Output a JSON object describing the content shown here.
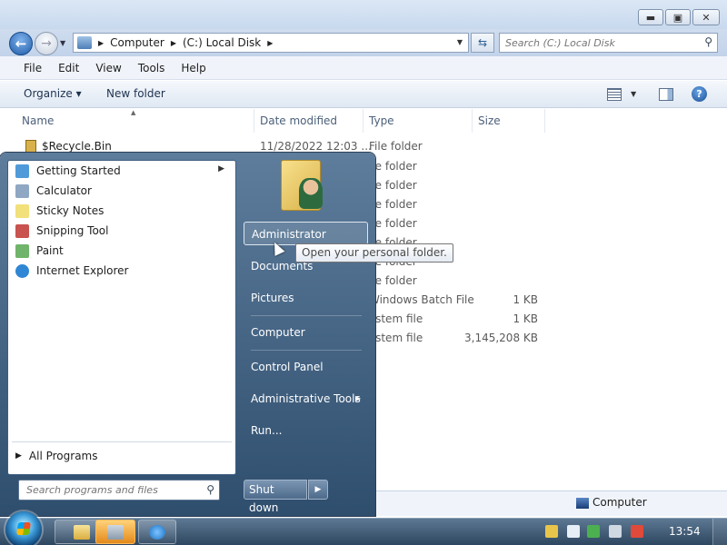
{
  "explorer": {
    "window_buttons": {
      "minimize": "▬",
      "maximize": "▣",
      "close": "✕"
    },
    "address": {
      "crumbs": [
        "Computer",
        "(C:) Local Disk"
      ]
    },
    "search": {
      "placeholder": "Search (C:) Local Disk"
    },
    "menu": [
      "File",
      "Edit",
      "View",
      "Tools",
      "Help"
    ],
    "commands": {
      "organize": "Organize ▾",
      "new_folder": "New folder"
    },
    "columns": [
      "Name",
      "Date modified",
      "Type",
      "Size"
    ],
    "files": [
      {
        "name": "$Recycle.Bin",
        "date": "11/28/2022 12:03 ...",
        "type": "File folder",
        "size": ""
      },
      {
        "name": "",
        "date": "",
        "type": "ile folder",
        "size": ""
      },
      {
        "name": "",
        "date": "",
        "type": "ile folder",
        "size": ""
      },
      {
        "name": "",
        "date": "",
        "type": "ile folder",
        "size": ""
      },
      {
        "name": "",
        "date": "",
        "type": "ile folder",
        "size": ""
      },
      {
        "name": "",
        "date": "",
        "type": "ile folder",
        "size": ""
      },
      {
        "name": "",
        "date": "",
        "type": "ile folder",
        "size": ""
      },
      {
        "name": "",
        "date": "",
        "type": "ile folder",
        "size": ""
      },
      {
        "name": "",
        "date": "",
        "type": "Windows Batch File",
        "size": "1 KB"
      },
      {
        "name": "",
        "date": "",
        "type": "ystem file",
        "size": "1 KB"
      },
      {
        "name": "",
        "date": "",
        "type": "ystem file",
        "size": "3,145,208 KB"
      }
    ],
    "status": {
      "location": "Computer"
    }
  },
  "startmenu": {
    "programs": [
      {
        "label": "Getting Started",
        "icon": "getting-started-icon",
        "color": "#4f9bd9",
        "submenu": true
      },
      {
        "label": "Calculator",
        "icon": "calculator-icon",
        "color": "#8fa7c2",
        "submenu": false
      },
      {
        "label": "Sticky Notes",
        "icon": "sticky-notes-icon",
        "color": "#f2e07a",
        "submenu": false
      },
      {
        "label": "Snipping Tool",
        "icon": "snipping-tool-icon",
        "color": "#c9534f",
        "submenu": false
      },
      {
        "label": "Paint",
        "icon": "paint-icon",
        "color": "#6fb46a",
        "submenu": false
      },
      {
        "label": "Internet Explorer",
        "icon": "internet-explorer-icon",
        "color": "#2f86d4",
        "submenu": false
      }
    ],
    "all_programs": "All Programs",
    "search_placeholder": "Search programs and files",
    "right": [
      {
        "label": "Administrator",
        "arrow": ""
      },
      {
        "label": "Documents",
        "arrow": ""
      },
      {
        "label": "Pictures",
        "arrow": ""
      },
      {
        "label": "Computer",
        "arrow": ""
      },
      {
        "label": "Control Panel",
        "arrow": ""
      },
      {
        "label": "Administrative Tools",
        "arrow": "▶"
      },
      {
        "label": "Run...",
        "arrow": ""
      }
    ],
    "shutdown": "Shut down",
    "shutdown_arrow": "▶",
    "tooltip": "Open your personal folder."
  },
  "taskbar": {
    "clock": "13:54"
  }
}
